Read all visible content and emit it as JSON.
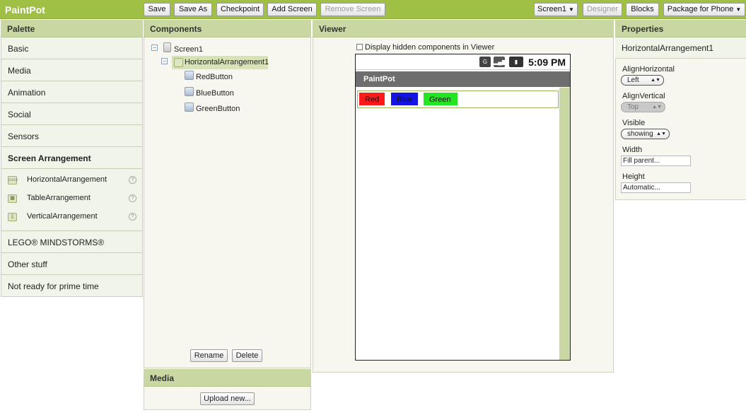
{
  "app": {
    "title": "PaintPot"
  },
  "toolbar": {
    "save": "Save",
    "save_as": "Save As",
    "checkpoint": "Checkpoint",
    "add_screen": "Add Screen",
    "remove_screen": "Remove Screen",
    "screen_select": "Screen1",
    "designer": "Designer",
    "blocks": "Blocks",
    "package": "Package for Phone"
  },
  "palette": {
    "title": "Palette",
    "categories": [
      "Basic",
      "Media",
      "Animation",
      "Social",
      "Sensors",
      "Screen Arrangement"
    ],
    "open_items": [
      "HorizontalArrangement",
      "TableArrangement",
      "VerticalArrangement"
    ],
    "help_glyph": "?",
    "more_categories": [
      "LEGO® MINDSTORMS®",
      "Other stuff",
      "Not ready for prime time"
    ]
  },
  "components": {
    "title": "Components",
    "tree": {
      "screen": "Screen1",
      "arrangement": "HorizontalArrangement1",
      "children": [
        "RedButton",
        "BlueButton",
        "GreenButton"
      ]
    },
    "rename": "Rename",
    "delete": "Delete"
  },
  "media": {
    "title": "Media",
    "upload": "Upload new..."
  },
  "viewer": {
    "title": "Viewer",
    "hidden_checkbox": "Display hidden components in Viewer",
    "phone": {
      "time": "5:09 PM",
      "app_title": "PaintPot",
      "buttons": [
        {
          "label": "Red",
          "color": "#ff1a1a"
        },
        {
          "label": "Blue",
          "color": "#1414e6"
        },
        {
          "label": "Green",
          "color": "#22e622"
        }
      ]
    }
  },
  "properties": {
    "title": "Properties",
    "component": "HorizontalArrangement1",
    "align_horizontal": {
      "label": "AlignHorizontal",
      "value": "Left"
    },
    "align_vertical": {
      "label": "AlignVertical",
      "value": "Top"
    },
    "visible": {
      "label": "Visible",
      "value": "showing"
    },
    "width": {
      "label": "Width",
      "value": "Fill parent..."
    },
    "height": {
      "label": "Height",
      "value": "Automatic..."
    }
  }
}
